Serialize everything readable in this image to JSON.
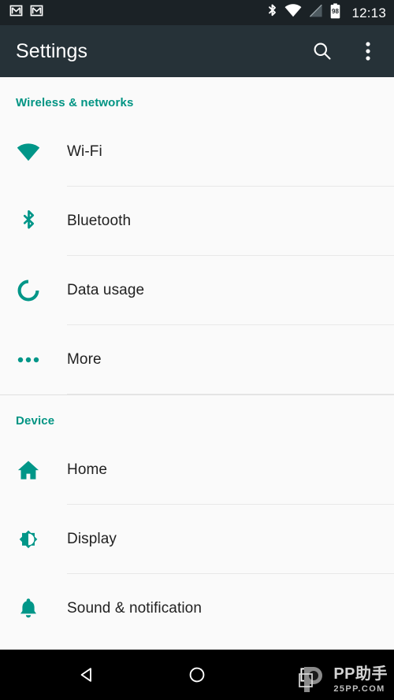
{
  "status_bar": {
    "notifications": [
      {
        "icon": "gmail-icon",
        "label": "Gmail"
      },
      {
        "icon": "gmail-icon",
        "label": "Gmail"
      }
    ],
    "system_icons": [
      {
        "icon": "bluetooth-icon",
        "label": "Bluetooth"
      },
      {
        "icon": "wifi-icon",
        "label": "Wi-Fi signal"
      },
      {
        "icon": "cellular-signal-icon",
        "label": "No cellular signal"
      },
      {
        "icon": "battery-icon",
        "label": "Battery"
      }
    ],
    "battery_level": "98",
    "clock": "12:13",
    "background_color": "#1b2226"
  },
  "toolbar": {
    "title": "Settings",
    "search_icon": "search-icon",
    "overflow_icon": "more-vert-icon",
    "background_color": "#263238"
  },
  "colors": {
    "accent": "#009688",
    "header_text": "#009483",
    "list_background": "#fafafa",
    "divider": "#e8e8e8",
    "primary_text": "#212121"
  },
  "sections": [
    {
      "header": "Wireless & networks",
      "items": [
        {
          "label": "Wi-Fi",
          "icon": "wifi-icon"
        },
        {
          "label": "Bluetooth",
          "icon": "bluetooth-icon"
        },
        {
          "label": "Data usage",
          "icon": "data-usage-icon"
        },
        {
          "label": "More",
          "icon": "more-horiz-icon"
        }
      ]
    },
    {
      "header": "Device",
      "items": [
        {
          "label": "Home",
          "icon": "home-icon"
        },
        {
          "label": "Display",
          "icon": "brightness-icon"
        },
        {
          "label": "Sound & notification",
          "icon": "bell-icon"
        }
      ]
    }
  ],
  "nav_bar": {
    "back_label": "Back",
    "home_label": "Home",
    "recents_label": "Recent apps",
    "background_color": "#000000"
  },
  "watermark": {
    "main": "PP助手",
    "sub": "25PP.COM"
  }
}
